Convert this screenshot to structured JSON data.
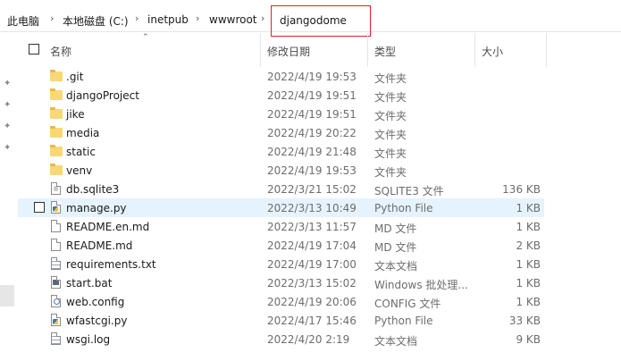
{
  "breadcrumb": {
    "items": [
      "此电脑",
      "本地磁盘 (C:)",
      "inetpub",
      "wwwroot"
    ],
    "current": "djangodome",
    "separator": "›"
  },
  "columns": {
    "name": "名称",
    "date": "修改日期",
    "type": "类型",
    "size": "大小"
  },
  "rows": [
    {
      "icon": "folder-icon",
      "name": ".git",
      "date": "2022/4/19 19:53",
      "type": "文件夹",
      "size": ""
    },
    {
      "icon": "folder-icon",
      "name": "djangoProject",
      "date": "2022/4/19 19:51",
      "type": "文件夹",
      "size": ""
    },
    {
      "icon": "folder-icon",
      "name": "jike",
      "date": "2022/4/19 19:51",
      "type": "文件夹",
      "size": ""
    },
    {
      "icon": "folder-icon",
      "name": "media",
      "date": "2022/4/19 20:22",
      "type": "文件夹",
      "size": ""
    },
    {
      "icon": "folder-icon",
      "name": "static",
      "date": "2022/4/19 21:48",
      "type": "文件夹",
      "size": ""
    },
    {
      "icon": "folder-icon",
      "name": "venv",
      "date": "2022/4/19 19:53",
      "type": "文件夹",
      "size": ""
    },
    {
      "icon": "database-file-icon",
      "name": "db.sqlite3",
      "date": "2022/3/21 15:02",
      "type": "SQLITE3 文件",
      "size": "136 KB"
    },
    {
      "icon": "python-file-icon",
      "name": "manage.py",
      "date": "2022/3/13 10:49",
      "type": "Python File",
      "size": "1 KB",
      "selected": true
    },
    {
      "icon": "blank-file-icon",
      "name": "README.en.md",
      "date": "2022/3/13 11:57",
      "type": "MD 文件",
      "size": "1 KB"
    },
    {
      "icon": "blank-file-icon",
      "name": "README.md",
      "date": "2022/4/19 17:04",
      "type": "MD 文件",
      "size": "2 KB"
    },
    {
      "icon": "text-file-icon",
      "name": "requirements.txt",
      "date": "2022/4/19 17:00",
      "type": "文本文档",
      "size": "1 KB"
    },
    {
      "icon": "batch-file-icon",
      "name": "start.bat",
      "date": "2022/3/13 15:02",
      "type": "Windows 批处理...",
      "size": "1 KB"
    },
    {
      "icon": "config-file-icon",
      "name": "web.config",
      "date": "2022/4/19 20:06",
      "type": "CONFIG 文件",
      "size": "1 KB"
    },
    {
      "icon": "python-file-icon",
      "name": "wfastcgi.py",
      "date": "2022/4/17 15:46",
      "type": "Python File",
      "size": "33 KB"
    },
    {
      "icon": "text-file-icon",
      "name": "wsgi.log",
      "date": "2022/4/20 2:19",
      "type": "文本文档",
      "size": "9 KB"
    }
  ],
  "colors": {
    "selection": "#e5f3ff",
    "highlight_border": "#d9232d",
    "folder": "#f8d775"
  }
}
